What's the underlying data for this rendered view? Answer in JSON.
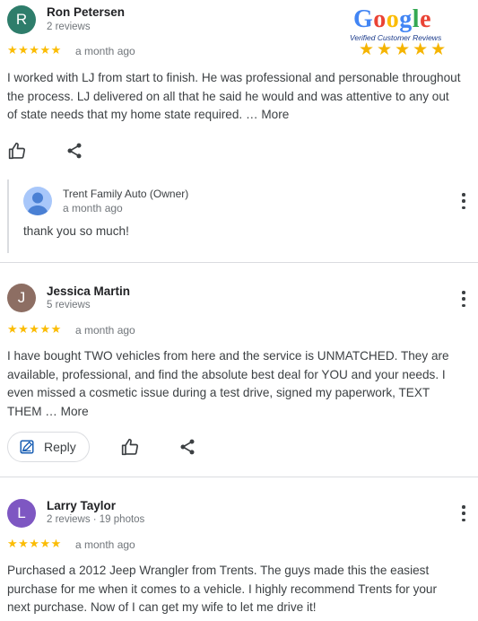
{
  "badge": {
    "brand": "Google",
    "caption": "Verified Customer Reviews",
    "stars": "★★★★★",
    "colors": [
      "#4285f4",
      "#ea4335",
      "#fbbc05",
      "#4285f4",
      "#34a853",
      "#ea4335"
    ]
  },
  "reviews": [
    {
      "initial": "R",
      "avatar_color": "#2e7d6b",
      "name": "Ron Petersen",
      "meta": "2 reviews",
      "stars": "★★★★★",
      "time": "a month ago",
      "text_lines": [
        "I worked with LJ from start to finish. He was professional and personable throughout",
        "the process. LJ delivered on all that he said he would and was attentive to any out",
        "of state needs that my home state required. …"
      ],
      "more_label": "More",
      "owner_reply": {
        "name": "Trent Family Auto (Owner)",
        "time": "a month ago",
        "text": "thank you so much!"
      }
    },
    {
      "initial": "J",
      "avatar_color": "#8d6e63",
      "name": "Jessica Martin",
      "meta": "5 reviews",
      "stars": "★★★★★",
      "time": "a month ago",
      "text_lines": [
        "I have bought TWO vehicles from here and the service is UNMATCHED. They are",
        "available, professional, and find the absolute best deal for YOU and your needs. I",
        "even missed a cosmetic issue during a test drive, signed my paperwork, TEXT",
        "THEM …"
      ],
      "more_label": "More",
      "reply_label": "Reply"
    },
    {
      "initial": "L",
      "avatar_color": "#7e57c2",
      "name": "Larry Taylor",
      "meta": "2 reviews · 19 photos",
      "stars": "★★★★★",
      "time": "a month ago",
      "text_lines": [
        "Purchased a 2012 Jeep Wrangler from Trents. The guys made this the easiest",
        "purchase for me when it comes to a vehicle. I highly recommend Trents for your",
        "next purchase. Now of I can get my wife to let me drive it!"
      ]
    }
  ]
}
